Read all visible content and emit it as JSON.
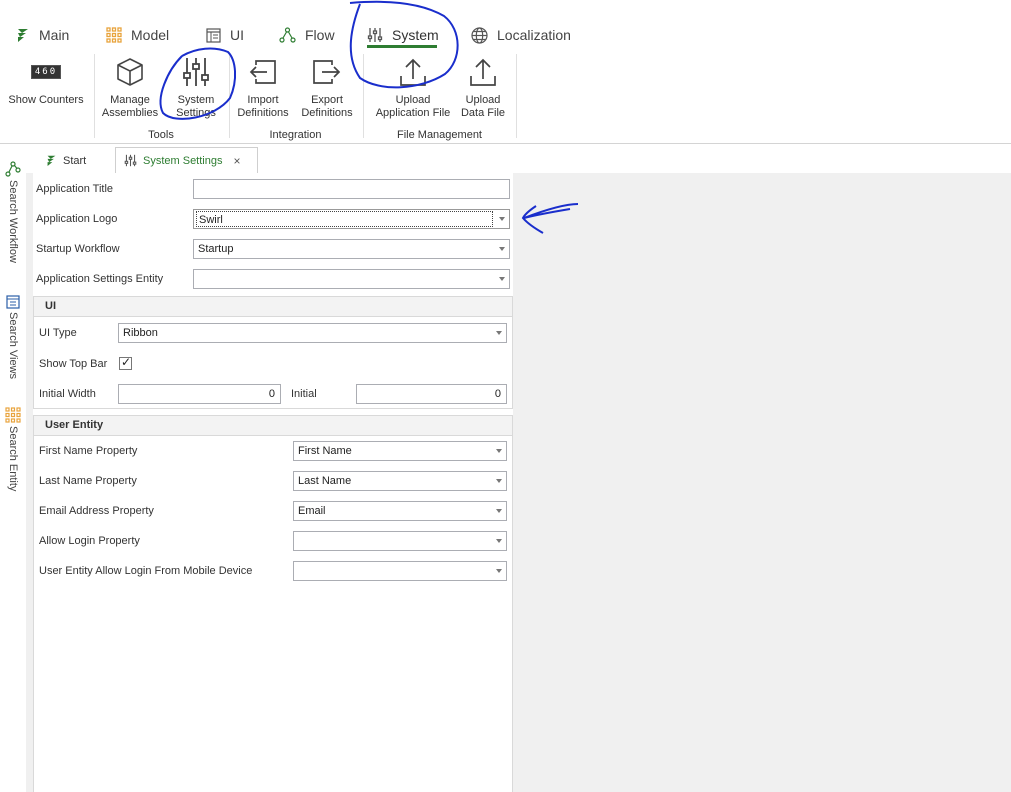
{
  "menu": {
    "tabs": [
      {
        "label": "Main"
      },
      {
        "label": "Model"
      },
      {
        "label": "UI"
      },
      {
        "label": "Flow"
      },
      {
        "label": "System"
      },
      {
        "label": "Localization"
      }
    ],
    "active": "System"
  },
  "ribbon": {
    "show_counters": {
      "label": "Show Counters",
      "digits": "460"
    },
    "manage_assemblies": {
      "line1": "Manage",
      "line2": "Assemblies"
    },
    "system_settings": {
      "line1": "System",
      "line2": "Settings"
    },
    "import_definitions": {
      "line1": "Import",
      "line2": "Definitions"
    },
    "export_definitions": {
      "line1": "Export",
      "line2": "Definitions"
    },
    "upload_application_file": {
      "line1": "Upload",
      "line2": "Application File"
    },
    "upload_data_file": {
      "line1": "Upload",
      "line2": "Data File"
    },
    "groups": {
      "tools": "Tools",
      "integration": "Integration",
      "file_management": "File Management"
    }
  },
  "side_bar": [
    {
      "label": "Search Workflow"
    },
    {
      "label": "Search Views"
    },
    {
      "label": "Search Entity"
    }
  ],
  "doc_tabs": [
    {
      "label": "Start"
    },
    {
      "label": "System Settings",
      "close": "×"
    }
  ],
  "form": {
    "application_title": {
      "label": "Application Title",
      "value": ""
    },
    "application_logo": {
      "label": "Application Logo",
      "value": "Swirl"
    },
    "startup_workflow": {
      "label": "Startup Workflow",
      "value": "Startup"
    },
    "application_settings_entity": {
      "label": "Application Settings Entity",
      "value": ""
    },
    "ui": {
      "heading": "UI",
      "ui_type": {
        "label": "UI Type",
        "value": "Ribbon"
      },
      "show_top_bar": {
        "label": "Show Top Bar",
        "checked": "✓"
      },
      "initial_width": {
        "label": "Initial Width",
        "value": "0"
      },
      "initial_other": {
        "label": "Initial",
        "value": "0"
      }
    },
    "user_entity": {
      "heading": "User Entity",
      "first_name_property": {
        "label": "First Name Property",
        "value": "First Name"
      },
      "last_name_property": {
        "label": "Last Name Property",
        "value": "Last Name"
      },
      "email_address_property": {
        "label": "Email Address Property",
        "value": "Email"
      },
      "allow_login_property": {
        "label": "Allow Login Property",
        "value": ""
      },
      "allow_login_mobile": {
        "label": "User Entity Allow Login From Mobile Device",
        "value": ""
      }
    }
  },
  "colors": {
    "accent_green": "#2e7d32",
    "orange": "#e8a33c",
    "annotation_blue": "#1a2ecc"
  }
}
